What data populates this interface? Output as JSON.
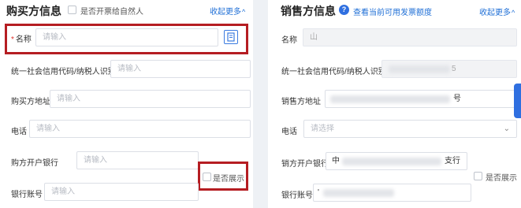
{
  "buyer": {
    "title": "购买方信息",
    "natural_person_label": "是否开票给自然人",
    "collapse_label": "收起更多",
    "name_label": "名称",
    "name_placeholder": "请输入",
    "credit_code_label": "统一社会信用代码/纳税人识别号",
    "credit_code_placeholder": "请输入",
    "address_label": "购买方地址",
    "address_placeholder": "请输入",
    "phone_label": "电话",
    "phone_placeholder": "请输入",
    "bank_label": "购方开户银行",
    "bank_placeholder": "请输入",
    "show_label": "是否展示",
    "account_label": "银行账号",
    "account_placeholder": "请输入"
  },
  "seller": {
    "title": "销售方信息",
    "help_icon": "?",
    "quota_link": "查看当前可用发票额度",
    "collapse_label": "收起更多",
    "name_label": "名称",
    "name_value": "山",
    "credit_code_label": "统一社会信用代码/纳税人识别号",
    "credit_code_value": "5",
    "address_label": "销售方地址",
    "address_value": "号",
    "phone_label": "电话",
    "phone_placeholder": "请选择",
    "bank_label": "销方开户银行",
    "bank_value_start": "中",
    "bank_value_end": "支行",
    "show_label": "是否展示",
    "account_label": "银行账号",
    "account_value": "'"
  },
  "icons": {
    "caret": "^",
    "dropdown": "⌄"
  },
  "colors": {
    "accent": "#1f6fd6",
    "highlight": "#b51d22",
    "required": "#e0322b"
  }
}
